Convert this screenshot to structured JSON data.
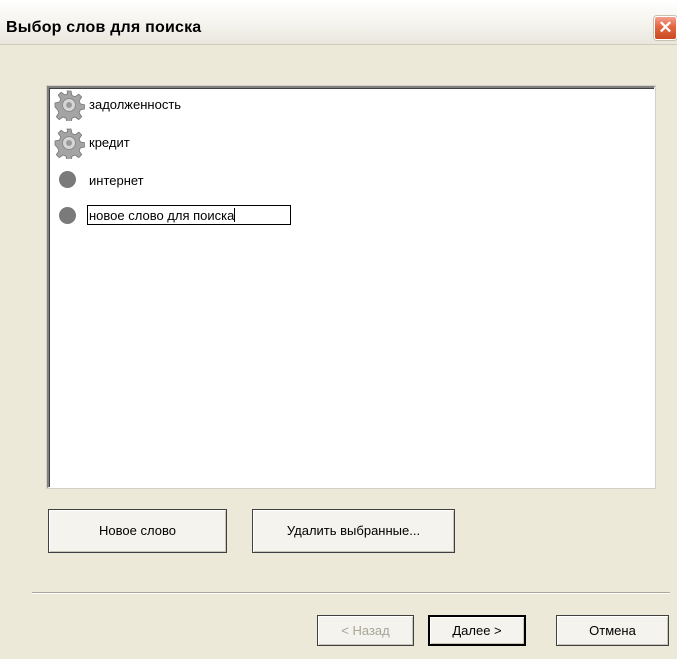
{
  "window": {
    "title": "Выбор слов для поиска",
    "close_icon": "close-x-icon",
    "close_glyph": "✕",
    "close_color": "#e2663f"
  },
  "word_list": {
    "items": [
      {
        "label": "задолженность",
        "icon": "gear-icon"
      },
      {
        "label": "кредит",
        "icon": "gear-icon"
      },
      {
        "label": "интернет",
        "icon": "gray-circle-icon"
      },
      {
        "label": "новое слово для поиска",
        "icon": "gray-circle-icon",
        "editing": true
      }
    ]
  },
  "buttons": {
    "new_word": "Новое слово",
    "delete_selected": "Удалить выбранные...",
    "back": "< Назад",
    "next": "Далее >",
    "cancel": "Отмена"
  }
}
